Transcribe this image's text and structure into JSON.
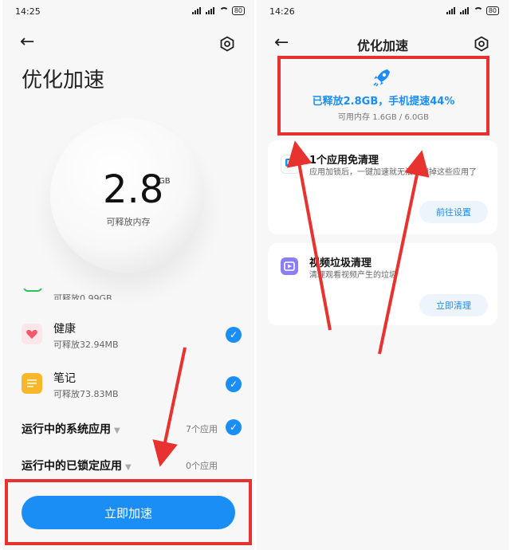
{
  "left": {
    "status_time": "14:25",
    "battery": "80",
    "title": "优化加速",
    "memory": {
      "value": "2.8",
      "unit": "GB",
      "label": "可释放内存"
    },
    "partial_item": "可释放0.99GB",
    "apps": [
      {
        "name": "健康",
        "sub": "可释放32.94MB",
        "color": "#f05a6a",
        "icon": "heart-icon"
      },
      {
        "name": "笔记",
        "sub": "可释放73.83MB",
        "color": "#f8b62a",
        "icon": "note-icon"
      }
    ],
    "sections": [
      {
        "title": "运行中的系统应用",
        "count": "7个应用"
      },
      {
        "title": "运行中的已锁定应用",
        "count": "0个应用"
      }
    ],
    "button": "立即加速"
  },
  "right": {
    "status_time": "14:26",
    "battery": "80",
    "title": "优化加速",
    "result_main": "已释放2.8GB，手机提速44%",
    "result_sub": "可用内存 1.6GB / 6.0GB",
    "cards": [
      {
        "title": "1个应用免清理",
        "desc": "应用加锁后，一键加速就无法清理掉这些应用了",
        "button": "前往设置",
        "icon": "lock-app-icon"
      },
      {
        "title": "视频垃圾清理",
        "desc": "清理观看视频产生的垃圾",
        "button": "立即清理",
        "icon": "video-clean-icon"
      }
    ]
  },
  "colors": {
    "accent": "#1a8ef5",
    "annotation": "#e8322f"
  }
}
